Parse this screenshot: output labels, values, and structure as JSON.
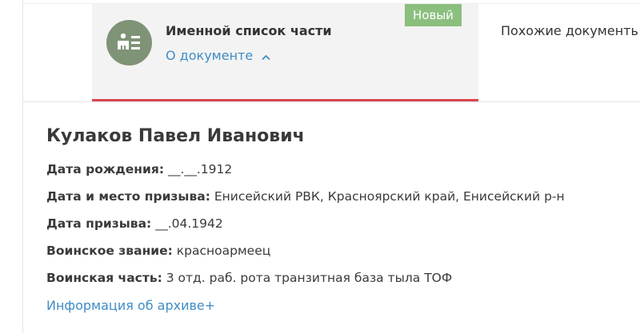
{
  "document": {
    "badge": "Новый",
    "title": "Именной список части",
    "about_link": "О документе",
    "icon": "document-list-icon",
    "similar_tab": "Похожие документь",
    "colors": {
      "badge": "#8bbf7e",
      "icon_bg": "#7f9376",
      "tab_underline": "#d9454d",
      "link": "#3f8dc6"
    }
  },
  "person": {
    "name": "Кулаков Павел Иванович",
    "fields": [
      {
        "label": "Дата рождения:",
        "value": " __.__.1912"
      },
      {
        "label": "Дата и место призыва:",
        "value": " Енисейский РВК, Красноярский край, Енисейский р-н"
      },
      {
        "label": "Дата призыва:",
        "value": " __.04.1942"
      },
      {
        "label": "Воинское звание:",
        "value": " красноармеец"
      },
      {
        "label": "Воинская часть:",
        "value": " 3 отд. раб. рота транзитная база тыла ТОФ"
      }
    ],
    "archive_link": "Информация об архиве+"
  }
}
